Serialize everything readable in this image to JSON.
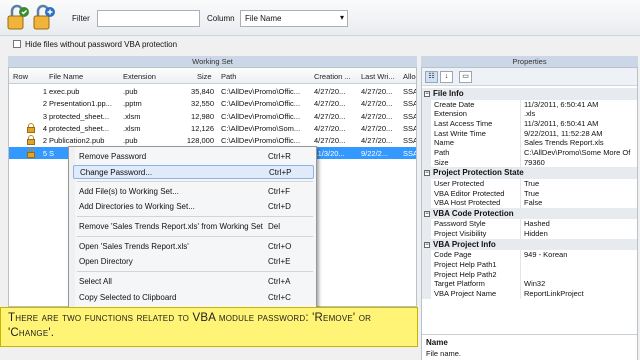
{
  "toolbar": {
    "filter_label": "Filter",
    "filter_value": "",
    "column_label": "Column",
    "column_value": "File Name"
  },
  "hide_files_label": "Hide files without password VBA protection",
  "working_set": {
    "title": "Working Set",
    "columns": [
      "Row",
      "File Name",
      "Extension",
      "Size",
      "Path",
      "Creation ...",
      "Last Wri...",
      "Alloc"
    ],
    "rows": [
      {
        "row": "1",
        "name": "exec.pub",
        "ext": ".pub",
        "size": "35,840",
        "path": "C:\\AllDev\\Promo\\Offic...",
        "created": "4/27/20...",
        "last": "4/27/20...",
        "alloc": "SSA",
        "locked": false,
        "selected": false
      },
      {
        "row": "2",
        "name": "Presentation1.pp...",
        "ext": ".pptm",
        "size": "32,550",
        "path": "C:\\AllDev\\Promo\\Offic...",
        "created": "4/27/20...",
        "last": "4/27/20...",
        "alloc": "SSA",
        "locked": false,
        "selected": false
      },
      {
        "row": "3",
        "name": "protected_sheet...",
        "ext": ".xlsm",
        "size": "12,980",
        "path": "C:\\AllDev\\Promo\\Offic...",
        "created": "4/27/20...",
        "last": "4/27/20...",
        "alloc": "SSA",
        "locked": false,
        "selected": false
      },
      {
        "row": "4",
        "name": "protected_sheet...",
        "ext": ".xlsm",
        "size": "12,126",
        "path": "C:\\AllDev\\Promo\\Som...",
        "created": "4/27/20...",
        "last": "4/27/20...",
        "alloc": "SSA",
        "locked": true,
        "selected": false
      },
      {
        "row": "2",
        "name": "Publication2.pub",
        "ext": ".pub",
        "size": "128,000",
        "path": "C:\\AllDev\\Promo\\Offic...",
        "created": "4/27/20...",
        "last": "4/27/20...",
        "alloc": "SSA",
        "locked": true,
        "selected": false
      },
      {
        "row": "5",
        "name": "S",
        "ext": "",
        "size": "",
        "path": "",
        "created": "11/3/20...",
        "last": "9/22/2...",
        "alloc": "SSA",
        "locked": true,
        "selected": true
      }
    ]
  },
  "context_menu": {
    "items": [
      {
        "label": "Remove Password",
        "shortcut": "Ctrl+R",
        "highlighted": false
      },
      {
        "label": "Change Password...",
        "shortcut": "Ctrl+P",
        "highlighted": true
      },
      {
        "label": "Add File(s) to Working Set...",
        "shortcut": "Ctrl+F",
        "highlighted": false
      },
      {
        "label": "Add Directories to Working Set...",
        "shortcut": "Ctrl+D",
        "highlighted": false
      },
      {
        "label": "Remove 'Sales Trends Report.xls' from Working Set",
        "shortcut": "Del",
        "highlighted": false
      },
      {
        "label": "Open 'Sales Trends Report.xls'",
        "shortcut": "Ctrl+O",
        "highlighted": false
      },
      {
        "label": "Open Directory",
        "shortcut": "Ctrl+E",
        "highlighted": false
      },
      {
        "label": "Select All",
        "shortcut": "Ctrl+A",
        "highlighted": false
      },
      {
        "label": "Copy Selected to Clipboard",
        "shortcut": "Ctrl+C",
        "highlighted": false
      }
    ]
  },
  "properties": {
    "title": "Properties",
    "categories": [
      {
        "name": "File Info",
        "rows": [
          [
            "Create Date",
            "11/3/2011, 6:50:41 AM"
          ],
          [
            "Extension",
            ".xls"
          ],
          [
            "Last Access Time",
            "11/3/2011, 6:50:41 AM"
          ],
          [
            "Last Write Time",
            "9/22/2011, 11:52:28 AM"
          ],
          [
            "Name",
            "Sales Trends Report.xls"
          ],
          [
            "Path",
            "C:\\AllDev\\Promo\\Some More Of"
          ],
          [
            "Size",
            "79360"
          ]
        ]
      },
      {
        "name": "Project Protection State",
        "rows": [
          [
            "User Protected",
            "True"
          ],
          [
            "VBA Editor Protected",
            "True"
          ],
          [
            "VBA Host Protected",
            "False"
          ]
        ]
      },
      {
        "name": "VBA Code Protection",
        "rows": [
          [
            "Password Style",
            "Hashed"
          ],
          [
            "Project Visibility",
            "Hidden"
          ]
        ]
      },
      {
        "name": "VBA Project Info",
        "rows": [
          [
            "Code Page",
            "949 - Korean"
          ],
          [
            "Project Help Path1",
            ""
          ],
          [
            "Project Help Path2",
            ""
          ],
          [
            "Target Platform",
            "Win32"
          ],
          [
            "VBA Project Name",
            "ReportLinkProject"
          ]
        ]
      }
    ],
    "desc_title": "Name",
    "desc_text": "File name."
  },
  "caption": "There are two functions related to VBA module password: 'Remove' or 'Change'."
}
